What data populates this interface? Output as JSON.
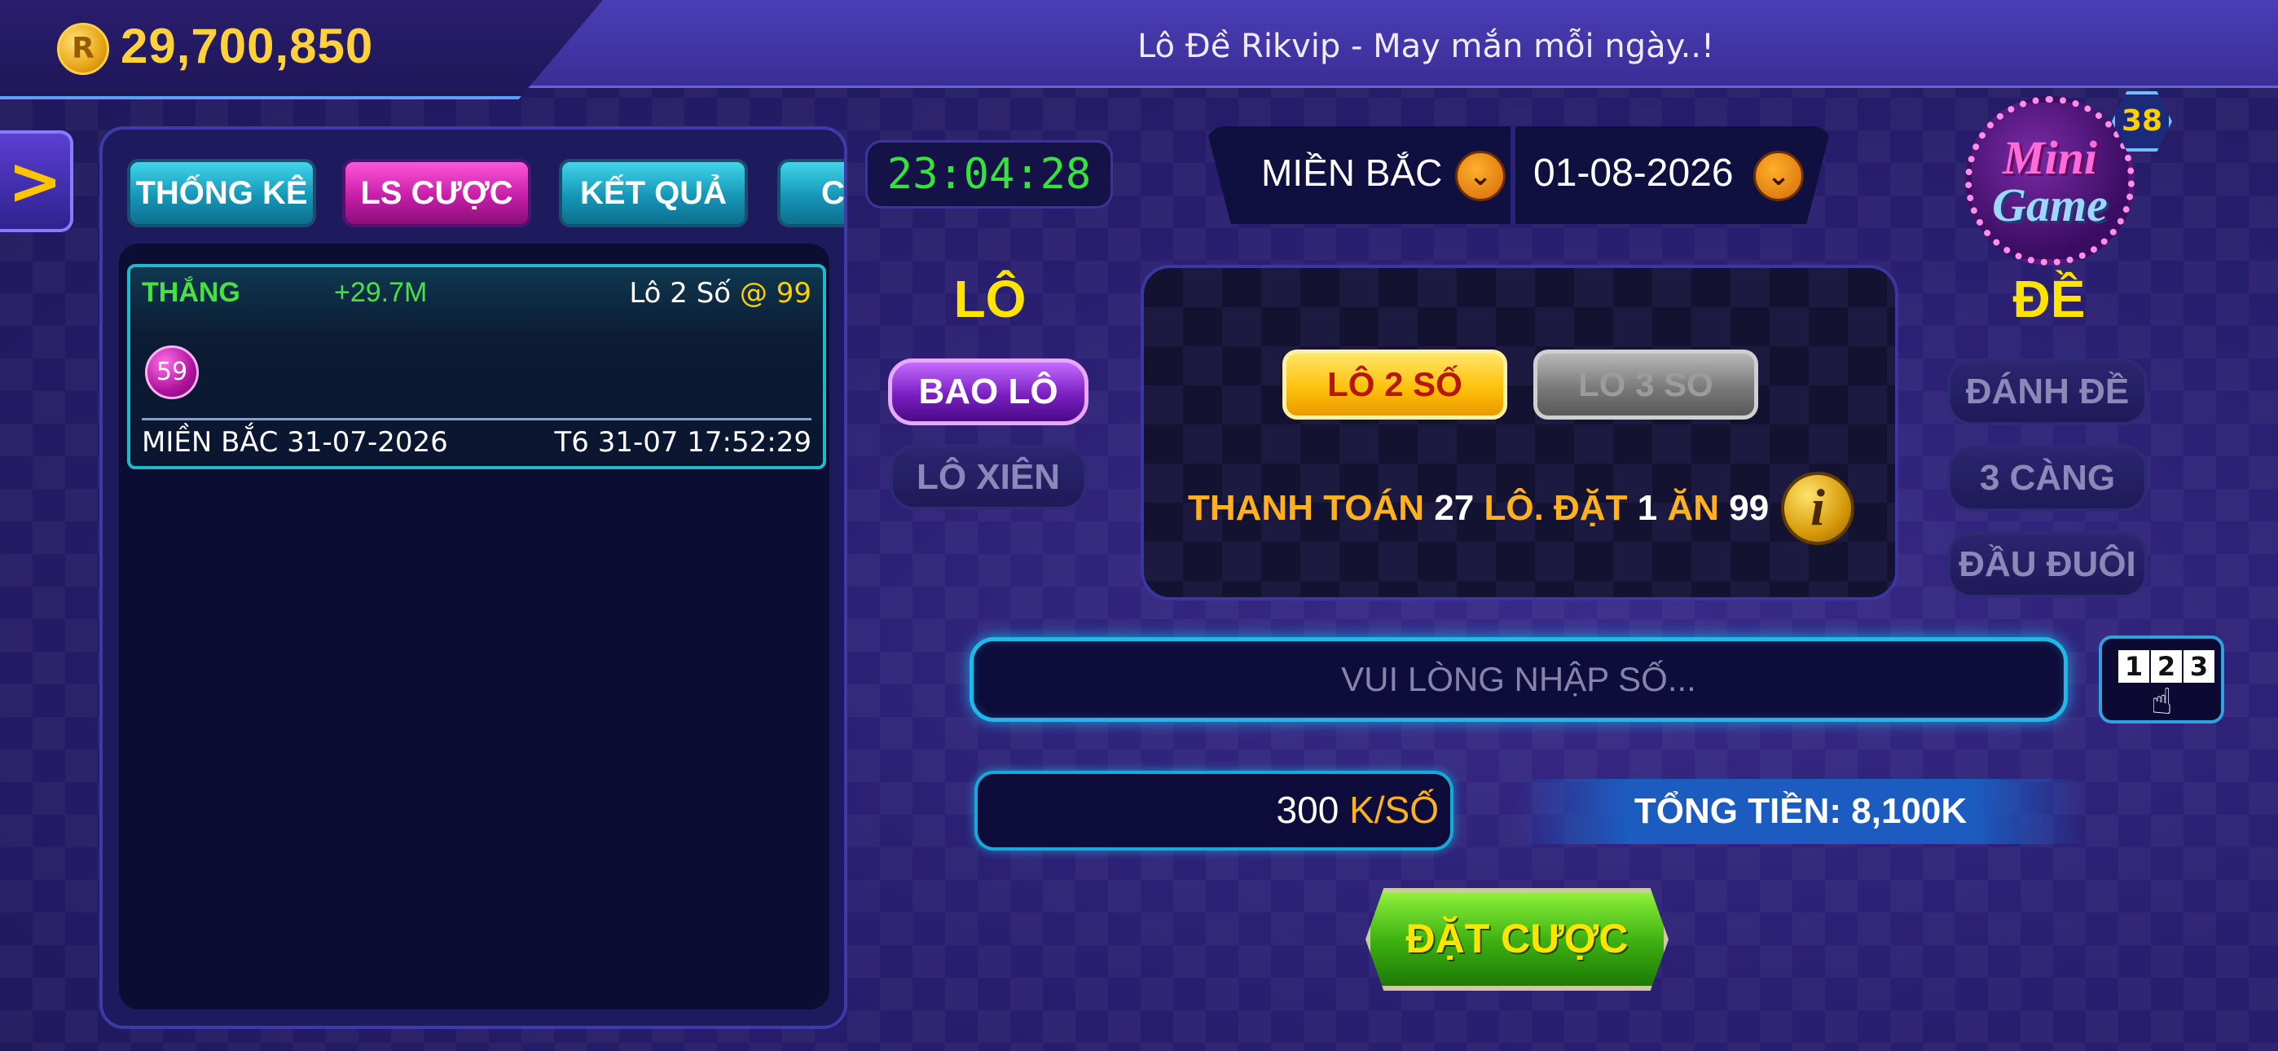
{
  "header": {
    "balance": "29,700,850",
    "coin_symbol": "R",
    "title": "Lô Đề Rikvip - May mắn mỗi ngày..!"
  },
  "side_arrow": ">",
  "tabs": [
    {
      "label": "THỐNG KÊ",
      "active": false
    },
    {
      "label": "LS CƯỢC",
      "active": true
    },
    {
      "label": "KẾT QUẢ",
      "active": false
    },
    {
      "label": "C",
      "active": false
    }
  ],
  "bet_history": [
    {
      "status": "THẮNG",
      "amount": "+29.7M",
      "type": "Lô 2 Số",
      "odds": "@ 99",
      "number": "59",
      "region_date": "MIỀN BẮC 31-07-2026",
      "time": "T6 31-07 17:52:29"
    }
  ],
  "timer": "23:04:28",
  "selector": {
    "region": "MIỀN BẮC",
    "date": "01-08-2026",
    "chevron": "⌄"
  },
  "minigame": {
    "line1": "Mini",
    "line2": "Game",
    "badge": "38"
  },
  "lo": {
    "title": "LÔ",
    "options": [
      {
        "label": "BAO LÔ",
        "active": true
      },
      {
        "label": "LÔ XIÊN",
        "active": false
      }
    ]
  },
  "de": {
    "title": "ĐỀ",
    "options": [
      {
        "label": "ĐÁNH ĐỀ",
        "active": false
      },
      {
        "label": "3 CÀNG",
        "active": false
      },
      {
        "label": "ĐẦU ĐUÔI",
        "active": false
      }
    ]
  },
  "bet_type": {
    "option1": "LÔ 2 SỐ",
    "option2": "LÔ 3 SỐ"
  },
  "payline": {
    "pay_label": "THANH TOÁN",
    "pay_value": "27",
    "bet_label": "LÔ. ĐẶT",
    "bet_value": "1",
    "win_label": "ĂN",
    "win_value": "99"
  },
  "number_input": {
    "placeholder": "VUI LÒNG NHẬP SỐ..."
  },
  "keypad": {
    "n1": "1",
    "n2": "2",
    "n3": "3"
  },
  "amount": {
    "value": "300",
    "unit": "K/SỐ"
  },
  "total": "TỔNG TIỀN: 8,100K",
  "bet_button": "ĐẶT CƯỢC",
  "colors": {
    "accent_yellow": "#ffe400",
    "win_green": "#49e046",
    "tab_active": "#c61ea8",
    "tab_inactive": "#1696b7"
  }
}
